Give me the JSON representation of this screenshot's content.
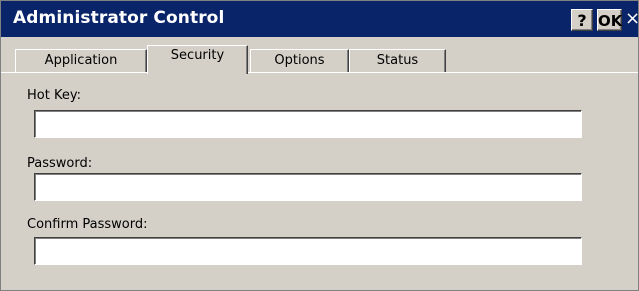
{
  "window": {
    "title": "Administrator Control",
    "help_label": "?",
    "ok_label": "OK",
    "close_label": "×",
    "colors": {
      "titlebar": "#0a246a",
      "face": "#d4d0c8"
    }
  },
  "tabs": [
    {
      "label": "Application",
      "active": false
    },
    {
      "label": "Security",
      "active": true
    },
    {
      "label": "Options",
      "active": false
    },
    {
      "label": "Status",
      "active": false
    }
  ],
  "form": {
    "hotkey": {
      "label": "Hot Key:",
      "value": ""
    },
    "password": {
      "label": "Password:",
      "value": ""
    },
    "confirm_password": {
      "label": "Confirm Password:",
      "value": ""
    }
  },
  "icons": {
    "help": "question-mark",
    "close": "x-mark"
  }
}
